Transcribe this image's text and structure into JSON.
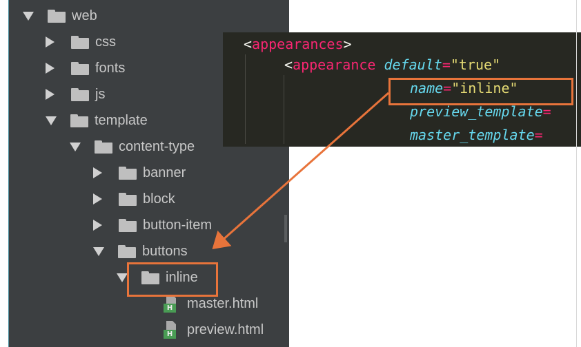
{
  "tree": {
    "items": [
      {
        "label": "web",
        "state": "expanded",
        "kind": "folder"
      },
      {
        "label": "css",
        "state": "collapsed",
        "kind": "folder"
      },
      {
        "label": "fonts",
        "state": "collapsed",
        "kind": "folder"
      },
      {
        "label": "js",
        "state": "collapsed",
        "kind": "folder"
      },
      {
        "label": "template",
        "state": "expanded",
        "kind": "folder"
      },
      {
        "label": "content-type",
        "state": "expanded",
        "kind": "folder"
      },
      {
        "label": "banner",
        "state": "collapsed",
        "kind": "folder"
      },
      {
        "label": "block",
        "state": "collapsed",
        "kind": "folder"
      },
      {
        "label": "button-item",
        "state": "collapsed",
        "kind": "folder"
      },
      {
        "label": "buttons",
        "state": "expanded",
        "kind": "folder"
      },
      {
        "label": "inline",
        "state": "expanded",
        "kind": "folder",
        "highlighted": true
      },
      {
        "label": "master.html",
        "kind": "html-file"
      },
      {
        "label": "preview.html",
        "kind": "html-file"
      }
    ],
    "html_badge": "H"
  },
  "code": {
    "line1": {
      "open": "<",
      "tag": "appearances",
      "close": ">"
    },
    "line2": {
      "open": "<",
      "tag": "appearance",
      "attr": "default",
      "eq": "=",
      "value": "\"true\""
    },
    "line3": {
      "attr": "name",
      "eq": "=",
      "value": "\"inline\""
    },
    "line4": {
      "attr": "preview_template",
      "eq": "="
    },
    "line5": {
      "attr": "master_template",
      "eq": "="
    }
  },
  "colors": {
    "highlight": "#e8743b",
    "tree_bg": "#3c3f41",
    "editor_bg": "#272822"
  },
  "icons": [
    "triangle-expanded-icon",
    "triangle-collapsed-icon",
    "folder-icon",
    "html-file-icon",
    "arrow-icon"
  ]
}
